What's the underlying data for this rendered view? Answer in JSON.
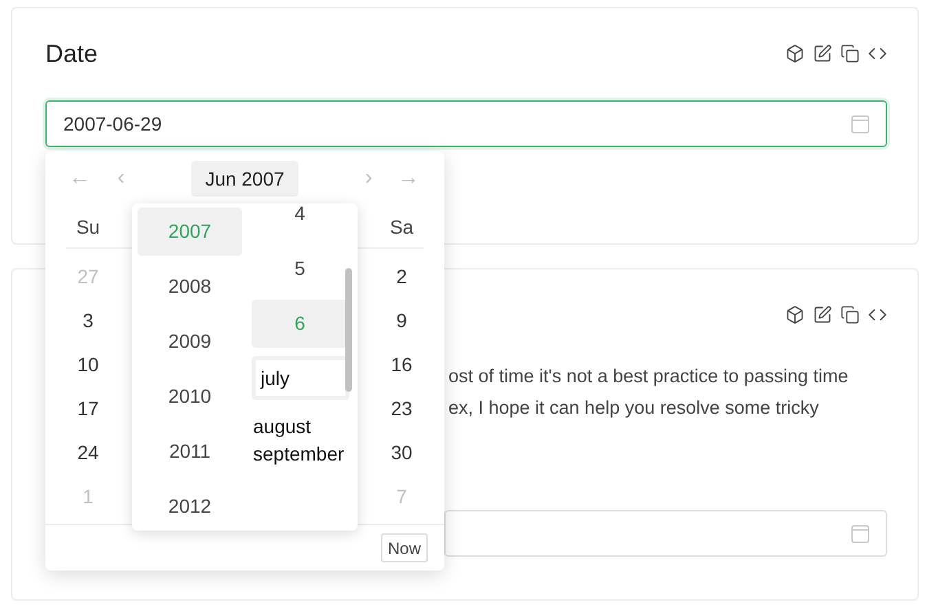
{
  "cards": [
    {
      "title": "Date",
      "field": {
        "value": "2007-06-29",
        "focused": true
      }
    },
    {
      "paragraph_lines": [
        "ost of time it's not a best practice to passing time",
        "ex, I hope it can help you resolve some tricky"
      ],
      "field": {
        "focused": false
      }
    }
  ],
  "picker": {
    "header": {
      "prev_year": "←",
      "prev_month": "‹",
      "title": "Jun 2007",
      "next_month": "›",
      "next_year": "→"
    },
    "weekdays": [
      "Su",
      "Sa"
    ],
    "weeks": [
      {
        "sun": {
          "day": "27",
          "muted": true
        },
        "sat": {
          "day": "2",
          "muted": false
        }
      },
      {
        "sun": {
          "day": "3",
          "muted": false
        },
        "sat": {
          "day": "9",
          "muted": false
        }
      },
      {
        "sun": {
          "day": "10",
          "muted": false
        },
        "sat": {
          "day": "16",
          "muted": false
        }
      },
      {
        "sun": {
          "day": "17",
          "muted": false
        },
        "sat": {
          "day": "23",
          "muted": false
        }
      },
      {
        "sun": {
          "day": "24",
          "muted": false
        },
        "sat": {
          "day": "30",
          "muted": false
        }
      },
      {
        "sun": {
          "day": "1",
          "muted": true
        },
        "sat": {
          "day": "7",
          "muted": true
        }
      }
    ],
    "years": [
      {
        "label": "2007",
        "selected": true
      },
      {
        "label": "2008",
        "selected": false
      },
      {
        "label": "2009",
        "selected": false
      },
      {
        "label": "2010",
        "selected": false
      },
      {
        "label": "2011",
        "selected": false
      },
      {
        "label": "2012",
        "selected": false
      }
    ],
    "months": [
      {
        "label": "4",
        "kind": "number",
        "selected": false
      },
      {
        "label": "5",
        "kind": "number",
        "selected": false
      },
      {
        "label": "6",
        "kind": "number",
        "selected": true
      },
      {
        "label": "july",
        "kind": "input"
      },
      {
        "label": "august",
        "kind": "text"
      },
      {
        "label": "september",
        "kind": "text"
      }
    ],
    "now_button": "Now"
  }
}
